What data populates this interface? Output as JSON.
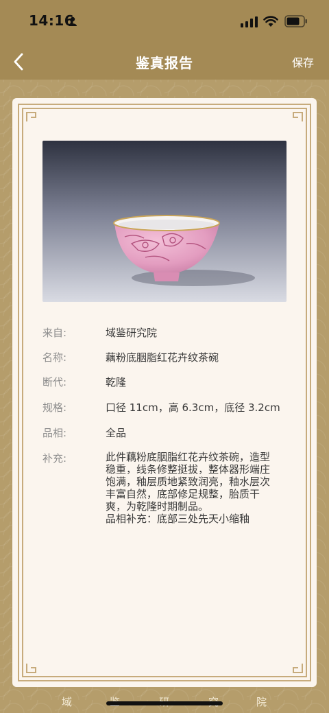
{
  "status": {
    "time": "14:16"
  },
  "nav": {
    "title": "鉴真报告",
    "save_label": "保存"
  },
  "report": {
    "rows": [
      {
        "label": "来自:",
        "value": "域鉴研究院"
      },
      {
        "label": "名称:",
        "value": "藕粉底胭脂红花卉纹茶碗"
      },
      {
        "label": "断代:",
        "value": "乾隆"
      },
      {
        "label": "规格:",
        "value": " 口径 11cm，高 6.3cm，底径 3.2cm"
      },
      {
        "label": "品相:",
        "value": "全品"
      },
      {
        "label": "补充:",
        "value": "此件藕粉底胭脂红花卉纹茶碗，造型\n稳重，线条修整挺拔，整体器形端庄\n饱满，釉层质地紧致润亮，釉水层次\n丰富自然，底部修足规整，胎质干\n爽，为乾隆时期制品。\n品相补充：底部三处先天小缩釉"
      }
    ]
  },
  "footer": {
    "chars": [
      "域",
      "鉴",
      "研",
      "究",
      "院"
    ]
  },
  "colors": {
    "gold": "#b59d6b",
    "card": "#fbf5ee",
    "frame": "#c7ab7c",
    "bowl_pink": "#e7a6c6"
  }
}
